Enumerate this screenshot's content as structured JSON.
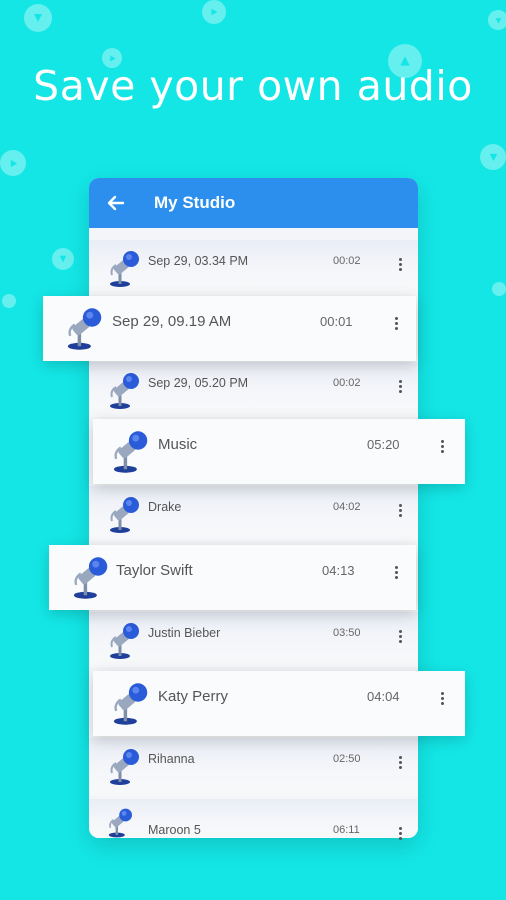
{
  "headline": "Save your own audio",
  "app": {
    "title": "My Studio"
  },
  "recordings": [
    {
      "name": "Sep 29, 03.34 PM",
      "duration": "00:02"
    },
    {
      "name": "Sep 29, 09.19 AM",
      "duration": "00:01"
    },
    {
      "name": "Sep 29, 05.20 PM",
      "duration": "00:02"
    },
    {
      "name": "Music",
      "duration": "05:20"
    },
    {
      "name": "Drake",
      "duration": "04:02"
    },
    {
      "name": "Taylor Swift",
      "duration": "04:13"
    },
    {
      "name": "Justin Bieber",
      "duration": "03:50"
    },
    {
      "name": "Katy Perry",
      "duration": "04:04"
    },
    {
      "name": "Rihanna",
      "duration": "02:50"
    },
    {
      "name": "Maroon 5",
      "duration": "06:11"
    }
  ],
  "icons": {
    "back": "back-arrow-icon",
    "row": "microphone-icon",
    "menu": "more-vertical-icon",
    "bubble": "play-icon"
  },
  "colors": {
    "background": "#14e6e6",
    "appbar": "#2c8fee",
    "mic": "#2a5bd8"
  }
}
